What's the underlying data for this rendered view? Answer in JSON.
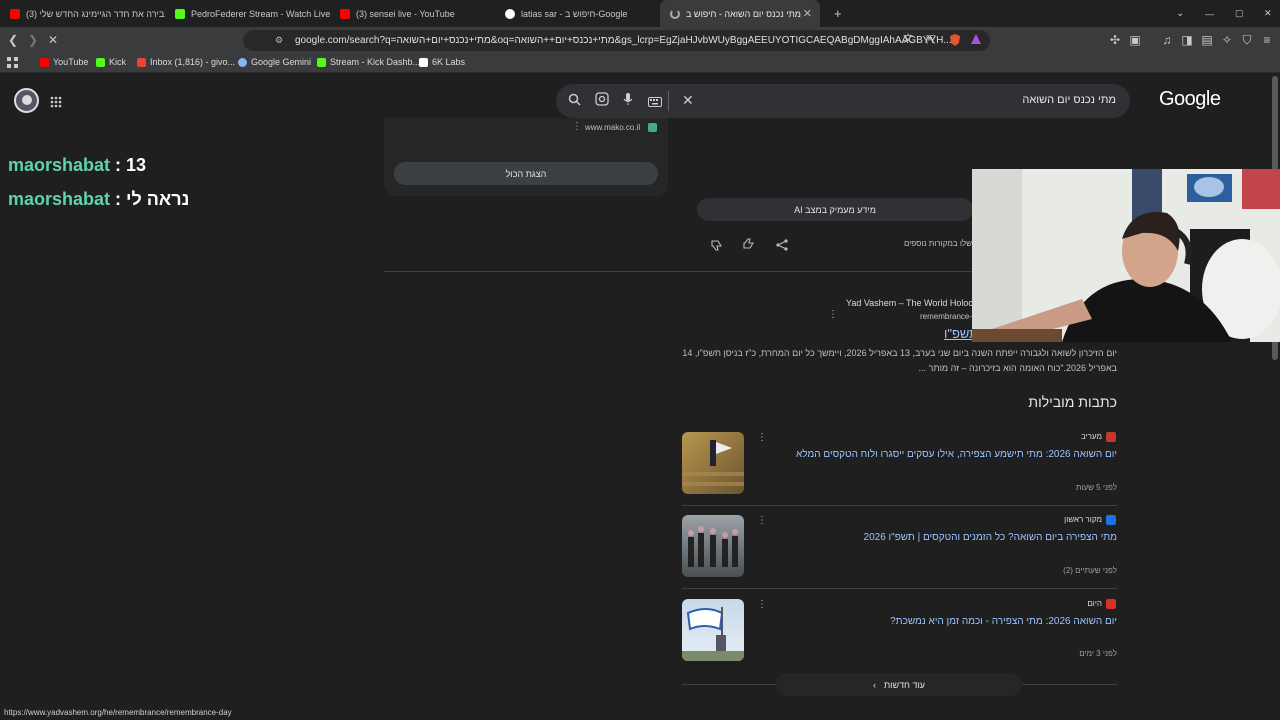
{
  "tabs": [
    {
      "title": "(3) תבירה את חדר הגיימינג החדש שלי",
      "favicon": "youtube-icon"
    },
    {
      "title": "PedroFederer Stream - Watch Live on Kick",
      "favicon": "kick-icon"
    },
    {
      "title": "(3) sensei live - YouTube",
      "favicon": "youtube-icon"
    },
    {
      "title": "latias sar - חיפוש ב-Google",
      "favicon": "google-icon"
    },
    {
      "title": "מתי נכנס יום השואה - חיפוש ב-Google",
      "favicon": "loading-icon"
    }
  ],
  "new_tab_label": "+",
  "window_controls": {
    "dropdown": "⌄",
    "minimize": "—",
    "maximize": "▢",
    "close": "✕"
  },
  "address": "google.com/search?q=מתי+נכנס+יום+השואה&oq=מתי+נכנס+יום++השואה&gs_lcrp=EgZjaHJvbWUyBggAEEUYOTIGCAEQABgDMggIAhAAGBYYH...",
  "bookmarks": [
    {
      "label": "YouTube",
      "icon": "youtube-icon",
      "color": "#ff0000"
    },
    {
      "label": "Kick",
      "icon": "kick-icon",
      "color": "#53fc18"
    },
    {
      "label": "Inbox (1,816) - givo...",
      "icon": "gmail-icon",
      "color": "#ea4335"
    },
    {
      "label": "Google Gemini",
      "icon": "gemini-icon",
      "color": "#8ab4f8"
    },
    {
      "label": "Stream - Kick Dashb...",
      "icon": "kick-icon",
      "color": "#53fc18"
    },
    {
      "label": "6K Labs",
      "icon": "labs-icon",
      "color": "#ffffff"
    }
  ],
  "google": {
    "logo": "Google",
    "query": "מתי נכנס יום השואה"
  },
  "ai_panel": {
    "source_domain": "www.mako.co.il",
    "show_all": "הצגת הכול",
    "dive_deeper": "מידע מעמיק במצב AI",
    "sources_note": "שלו במקורות נוספים"
  },
  "result": {
    "site_name": "Yad Vashem – The World Holocaust",
    "site_url": "remembrance-",
    "title_fragment": "תשפ\"ו",
    "snippet_line1": "יום הזיכרון לשואה ולגבורה ייפתח השנה ביום שני בערב, 13 באפריל 2026, ויימשך כל יום המחרת, כ\"ז בניסן תשפ\"ו, 14",
    "snippet_line2": "באפריל 2026.\"כוח האומה הוא בזיכרונה – זה מותר ..."
  },
  "top_stories": {
    "heading": "כתבות מובילות",
    "items": [
      {
        "source": "מעריב",
        "title": "יום השואה 2026: מתי תישמע הצפירה, אילו עסקים ייסגרו ולוח הטקסים המלא",
        "time": "לפני 5 שעות",
        "source_color": "#c0392b"
      },
      {
        "source": "מקור ראשון",
        "title": "מתי הצפירה ביום השואה? כל הזמנים והטקסים | תשפ\"ו 2026",
        "time": "לפני שעתיים (2)",
        "source_color": "#1a73e8"
      },
      {
        "source": "היום",
        "title": "יום השואה 2026: מתי הצפירה - וכמה זמן היא נמשכת?",
        "time": "לפני 3 ימים",
        "source_color": "#d93025"
      }
    ],
    "more_news": "עוד חדשות"
  },
  "chat": [
    {
      "user": "maorshabat",
      "message": "13"
    },
    {
      "user": "maorshabat",
      "message": "נראה לי"
    }
  ],
  "chat_colors": {
    "user": "#5fd3a8",
    "message": "#ffffff"
  },
  "status_url": "https://www.yadvashem.org/he/remembrance/remembrance-day"
}
